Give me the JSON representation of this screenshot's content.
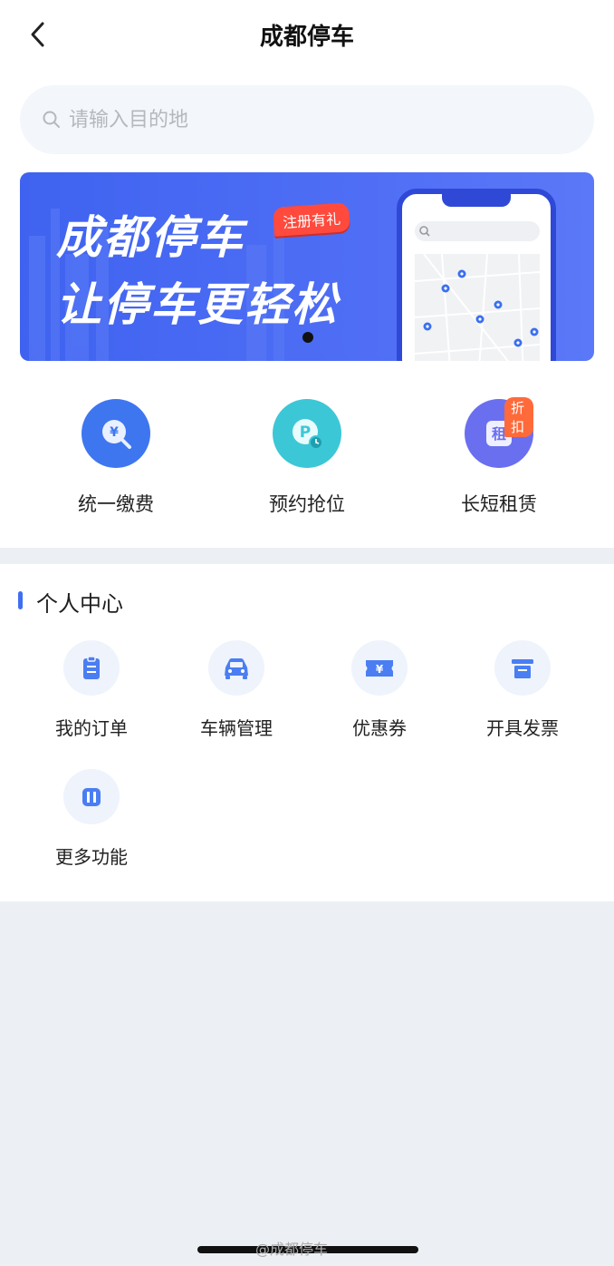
{
  "header": {
    "title": "成都停车",
    "back_icon": "chevron-left-icon"
  },
  "search": {
    "placeholder": "请输入目的地",
    "value": ""
  },
  "banner": {
    "line1": "成都停车",
    "line2": "让停车更轻松",
    "badge": "注册有礼",
    "background_color": "#4a6cf4"
  },
  "quick_actions": [
    {
      "label": "统一缴费",
      "icon": "yuan-search-icon",
      "color": "#3e76f0"
    },
    {
      "label": "预约抢位",
      "icon": "parking-clock-icon",
      "color": "#3cc7d6"
    },
    {
      "label": "长短租赁",
      "icon": "rent-icon",
      "color": "#6a6ff0",
      "tag": "折扣"
    }
  ],
  "personal_center": {
    "title": "个人中心",
    "accent_color": "#3e6ff2",
    "items": [
      {
        "label": "我的订单",
        "icon": "order-icon"
      },
      {
        "label": "车辆管理",
        "icon": "car-icon"
      },
      {
        "label": "优惠券",
        "icon": "coupon-icon"
      },
      {
        "label": "开具发票",
        "icon": "invoice-icon"
      },
      {
        "label": "更多功能",
        "icon": "more-icon"
      }
    ]
  },
  "watermark": "@成都停车"
}
